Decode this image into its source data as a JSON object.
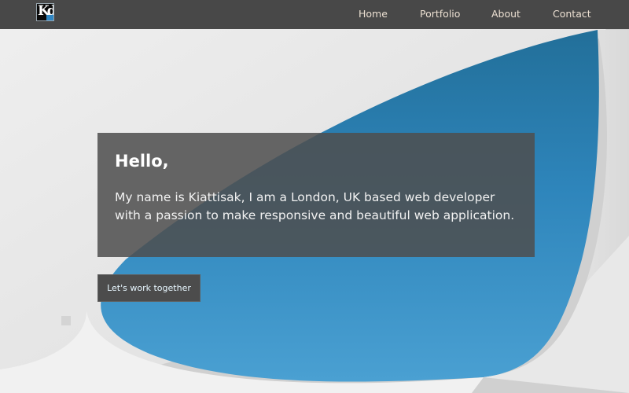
{
  "colors": {
    "nav_background": "#484848",
    "nav_text": "#ece0d2",
    "accent_blue": "#2f86c3",
    "card_background": "#4e4e4e",
    "button_text": "#e8f7ff"
  },
  "nav": {
    "logo_text": "Kd",
    "items": [
      {
        "label": "Home"
      },
      {
        "label": "Portfolio"
      },
      {
        "label": "About"
      },
      {
        "label": "Contact"
      }
    ]
  },
  "intro": {
    "greeting": "Hello,",
    "text": "My name is Kiattisak, I am a London, UK based web developer with a passion to make responsive and beautiful web application."
  },
  "cta": {
    "label": "Let's work together"
  }
}
